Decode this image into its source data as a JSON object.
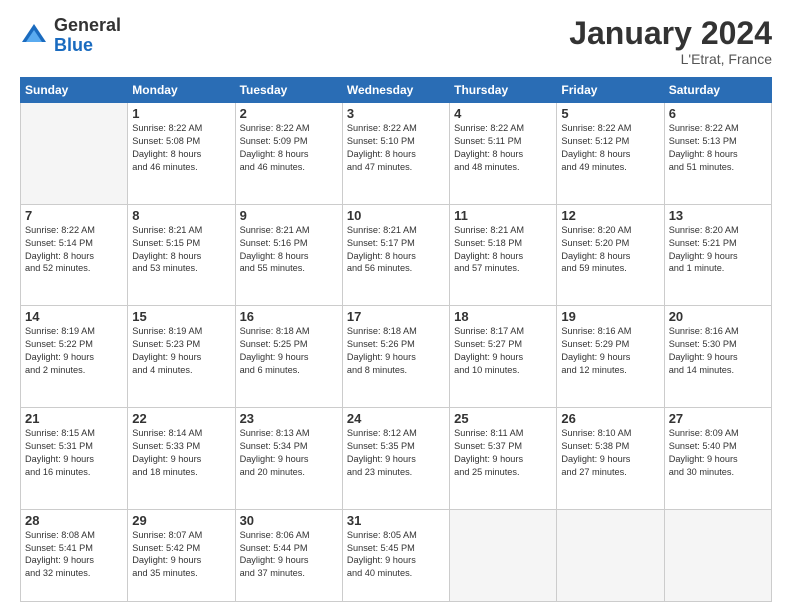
{
  "logo": {
    "general": "General",
    "blue": "Blue"
  },
  "header": {
    "month": "January 2024",
    "location": "L'Etrat, France"
  },
  "weekdays": [
    "Sunday",
    "Monday",
    "Tuesday",
    "Wednesday",
    "Thursday",
    "Friday",
    "Saturday"
  ],
  "weeks": [
    [
      {
        "day": "",
        "info": ""
      },
      {
        "day": "1",
        "info": "Sunrise: 8:22 AM\nSunset: 5:08 PM\nDaylight: 8 hours\nand 46 minutes."
      },
      {
        "day": "2",
        "info": "Sunrise: 8:22 AM\nSunset: 5:09 PM\nDaylight: 8 hours\nand 46 minutes."
      },
      {
        "day": "3",
        "info": "Sunrise: 8:22 AM\nSunset: 5:10 PM\nDaylight: 8 hours\nand 47 minutes."
      },
      {
        "day": "4",
        "info": "Sunrise: 8:22 AM\nSunset: 5:11 PM\nDaylight: 8 hours\nand 48 minutes."
      },
      {
        "day": "5",
        "info": "Sunrise: 8:22 AM\nSunset: 5:12 PM\nDaylight: 8 hours\nand 49 minutes."
      },
      {
        "day": "6",
        "info": "Sunrise: 8:22 AM\nSunset: 5:13 PM\nDaylight: 8 hours\nand 51 minutes."
      }
    ],
    [
      {
        "day": "7",
        "info": "Sunrise: 8:22 AM\nSunset: 5:14 PM\nDaylight: 8 hours\nand 52 minutes."
      },
      {
        "day": "8",
        "info": "Sunrise: 8:21 AM\nSunset: 5:15 PM\nDaylight: 8 hours\nand 53 minutes."
      },
      {
        "day": "9",
        "info": "Sunrise: 8:21 AM\nSunset: 5:16 PM\nDaylight: 8 hours\nand 55 minutes."
      },
      {
        "day": "10",
        "info": "Sunrise: 8:21 AM\nSunset: 5:17 PM\nDaylight: 8 hours\nand 56 minutes."
      },
      {
        "day": "11",
        "info": "Sunrise: 8:21 AM\nSunset: 5:18 PM\nDaylight: 8 hours\nand 57 minutes."
      },
      {
        "day": "12",
        "info": "Sunrise: 8:20 AM\nSunset: 5:20 PM\nDaylight: 8 hours\nand 59 minutes."
      },
      {
        "day": "13",
        "info": "Sunrise: 8:20 AM\nSunset: 5:21 PM\nDaylight: 9 hours\nand 1 minute."
      }
    ],
    [
      {
        "day": "14",
        "info": "Sunrise: 8:19 AM\nSunset: 5:22 PM\nDaylight: 9 hours\nand 2 minutes."
      },
      {
        "day": "15",
        "info": "Sunrise: 8:19 AM\nSunset: 5:23 PM\nDaylight: 9 hours\nand 4 minutes."
      },
      {
        "day": "16",
        "info": "Sunrise: 8:18 AM\nSunset: 5:25 PM\nDaylight: 9 hours\nand 6 minutes."
      },
      {
        "day": "17",
        "info": "Sunrise: 8:18 AM\nSunset: 5:26 PM\nDaylight: 9 hours\nand 8 minutes."
      },
      {
        "day": "18",
        "info": "Sunrise: 8:17 AM\nSunset: 5:27 PM\nDaylight: 9 hours\nand 10 minutes."
      },
      {
        "day": "19",
        "info": "Sunrise: 8:16 AM\nSunset: 5:29 PM\nDaylight: 9 hours\nand 12 minutes."
      },
      {
        "day": "20",
        "info": "Sunrise: 8:16 AM\nSunset: 5:30 PM\nDaylight: 9 hours\nand 14 minutes."
      }
    ],
    [
      {
        "day": "21",
        "info": "Sunrise: 8:15 AM\nSunset: 5:31 PM\nDaylight: 9 hours\nand 16 minutes."
      },
      {
        "day": "22",
        "info": "Sunrise: 8:14 AM\nSunset: 5:33 PM\nDaylight: 9 hours\nand 18 minutes."
      },
      {
        "day": "23",
        "info": "Sunrise: 8:13 AM\nSunset: 5:34 PM\nDaylight: 9 hours\nand 20 minutes."
      },
      {
        "day": "24",
        "info": "Sunrise: 8:12 AM\nSunset: 5:35 PM\nDaylight: 9 hours\nand 23 minutes."
      },
      {
        "day": "25",
        "info": "Sunrise: 8:11 AM\nSunset: 5:37 PM\nDaylight: 9 hours\nand 25 minutes."
      },
      {
        "day": "26",
        "info": "Sunrise: 8:10 AM\nSunset: 5:38 PM\nDaylight: 9 hours\nand 27 minutes."
      },
      {
        "day": "27",
        "info": "Sunrise: 8:09 AM\nSunset: 5:40 PM\nDaylight: 9 hours\nand 30 minutes."
      }
    ],
    [
      {
        "day": "28",
        "info": "Sunrise: 8:08 AM\nSunset: 5:41 PM\nDaylight: 9 hours\nand 32 minutes."
      },
      {
        "day": "29",
        "info": "Sunrise: 8:07 AM\nSunset: 5:42 PM\nDaylight: 9 hours\nand 35 minutes."
      },
      {
        "day": "30",
        "info": "Sunrise: 8:06 AM\nSunset: 5:44 PM\nDaylight: 9 hours\nand 37 minutes."
      },
      {
        "day": "31",
        "info": "Sunrise: 8:05 AM\nSunset: 5:45 PM\nDaylight: 9 hours\nand 40 minutes."
      },
      {
        "day": "",
        "info": ""
      },
      {
        "day": "",
        "info": ""
      },
      {
        "day": "",
        "info": ""
      }
    ]
  ]
}
